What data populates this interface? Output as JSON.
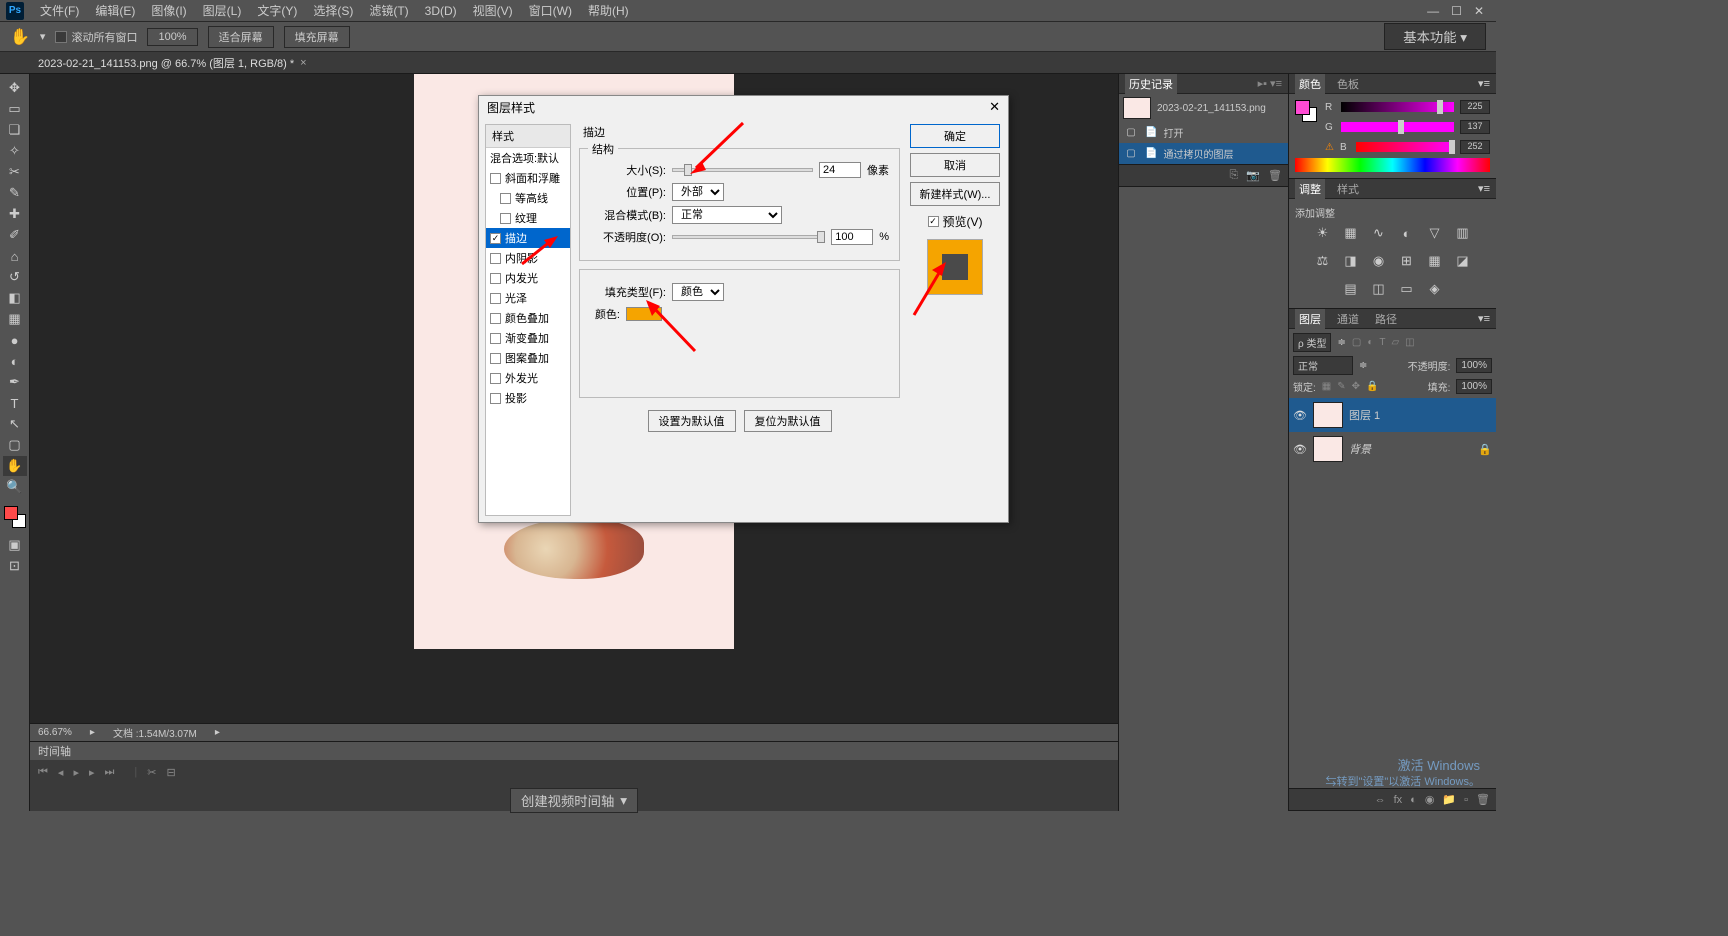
{
  "app": {
    "logo": "Ps"
  },
  "menu": {
    "file": "文件(F)",
    "edit": "编辑(E)",
    "image": "图像(I)",
    "layer": "图层(L)",
    "type": "文字(Y)",
    "select": "选择(S)",
    "filter": "滤镜(T)",
    "threeD": "3D(D)",
    "view": "视图(V)",
    "window": "窗口(W)",
    "help": "帮助(H)"
  },
  "options": {
    "toolIcon": "✋",
    "scrollAll": "滚动所有窗口",
    "zoom": "100%",
    "fitScreen": "适合屏幕",
    "fillScreen": "填充屏幕",
    "workspace": "基本功能"
  },
  "docTab": {
    "title": "2023-02-21_141153.png @ 66.7% (图层 1, RGB/8) *",
    "close": "×"
  },
  "status": {
    "zoom": "66.67%",
    "doc": "文档 :1.54M/3.07M"
  },
  "timeline": {
    "label": "时间轴",
    "create": "创建视频时间轴"
  },
  "dialog": {
    "title": "图层样式",
    "close": "✕",
    "stylesHeader": "样式",
    "items": [
      "混合选项:默认",
      "斜面和浮雕",
      "等高线",
      "纹理",
      "描边",
      "内阴影",
      "内发光",
      "光泽",
      "颜色叠加",
      "渐变叠加",
      "图案叠加",
      "外发光",
      "投影"
    ],
    "section1": "描边",
    "section1sub": "结构",
    "sizeLabel": "大小(S):",
    "sizeValue": "24",
    "sizeUnit": "像素",
    "positionLabel": "位置(P):",
    "positionValue": "外部",
    "blendLabel": "混合模式(B):",
    "blendValue": "正常",
    "opacityLabel": "不透明度(O):",
    "opacityValue": "100",
    "opacityUnit": "%",
    "section2": "",
    "fillLabel": "填充类型(F):",
    "fillValue": "颜色",
    "colorLabel": "颜色:",
    "setDefault": "设置为默认值",
    "resetDefault": "复位为默认值",
    "ok": "确定",
    "cancel": "取消",
    "newStyle": "新建样式(W)...",
    "previewLabel": "预览(V)"
  },
  "panels": {
    "historyTab": "历史记录",
    "colorTab": "颜色",
    "swatchTab": "色板",
    "adjustTab": "调整",
    "styleTab": "样式",
    "layersTab": "图层",
    "channelsTab": "通道",
    "pathsTab": "路径",
    "historyFile": "2023-02-21_141153.png",
    "historyOpen": "打开",
    "historyCopy": "通过拷贝的图层",
    "addAdjust": "添加调整",
    "r": "R",
    "g": "G",
    "b": "B",
    "rv": "225",
    "gv": "137",
    "bv": "252",
    "layersKind": "ρ 类型",
    "layersBlend": "正常",
    "layersOpacity": "不透明度:",
    "layersOpacityV": "100%",
    "layersLock": "锁定:",
    "layersFill": "填充:",
    "layersFillV": "100%",
    "layer1": "图层 1",
    "bgLayer": "背景"
  },
  "watermark": {
    "line1": "激活 Windows",
    "line2": "⇆转到\"设置\"以激活 Windows。"
  }
}
